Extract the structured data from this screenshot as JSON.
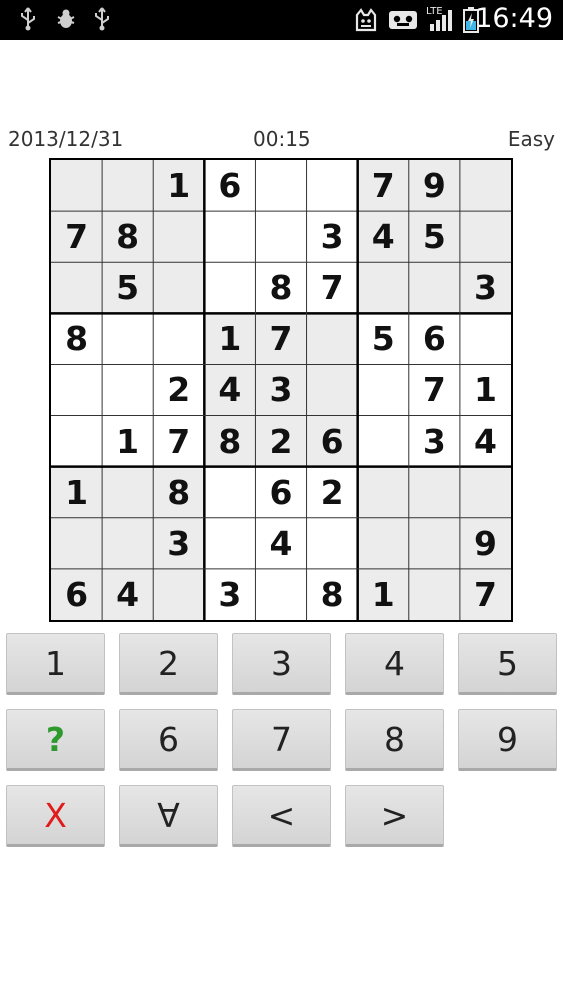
{
  "status_bar": {
    "left_icons": [
      "usb-icon",
      "debug-bug-icon",
      "usb-icon"
    ],
    "right_icons": [
      "notification-cat-icon",
      "voicemail-icon",
      "lte-signal-icon",
      "battery-charging-icon"
    ],
    "network_label": "LTE",
    "time": "16:49"
  },
  "info": {
    "date": "2013/12/31",
    "timer": "00:15",
    "difficulty": "Easy"
  },
  "board": {
    "rows": [
      [
        "",
        "",
        "1",
        "6",
        "",
        "",
        "7",
        "9",
        ""
      ],
      [
        "7",
        "8",
        "",
        "",
        "",
        "3",
        "4",
        "5",
        ""
      ],
      [
        "",
        "5",
        "",
        "",
        "8",
        "7",
        "",
        "",
        "3"
      ],
      [
        "8",
        "",
        "",
        "1",
        "7",
        "",
        "5",
        "6",
        ""
      ],
      [
        "",
        "",
        "2",
        "4",
        "3",
        "",
        "",
        "7",
        "1"
      ],
      [
        "",
        "1",
        "7",
        "8",
        "2",
        "6",
        "",
        "3",
        "4"
      ],
      [
        "1",
        "",
        "8",
        "",
        "6",
        "2",
        "",
        "",
        ""
      ],
      [
        "",
        "",
        "3",
        "",
        "4",
        "",
        "",
        "",
        "9"
      ],
      [
        "6",
        "4",
        "",
        "3",
        "",
        "8",
        "1",
        "",
        "7"
      ]
    ]
  },
  "keypad": {
    "rows": [
      [
        "1",
        "2",
        "3",
        "4",
        "5"
      ],
      [
        "?",
        "6",
        "7",
        "8",
        "9"
      ],
      [
        "X",
        "∀",
        "<",
        ">"
      ]
    ]
  },
  "colors": {
    "status_bg": "#000000",
    "shaded_cell": "#ececec",
    "hint_green": "#2e9a2e",
    "clear_red": "#e01b1b"
  }
}
